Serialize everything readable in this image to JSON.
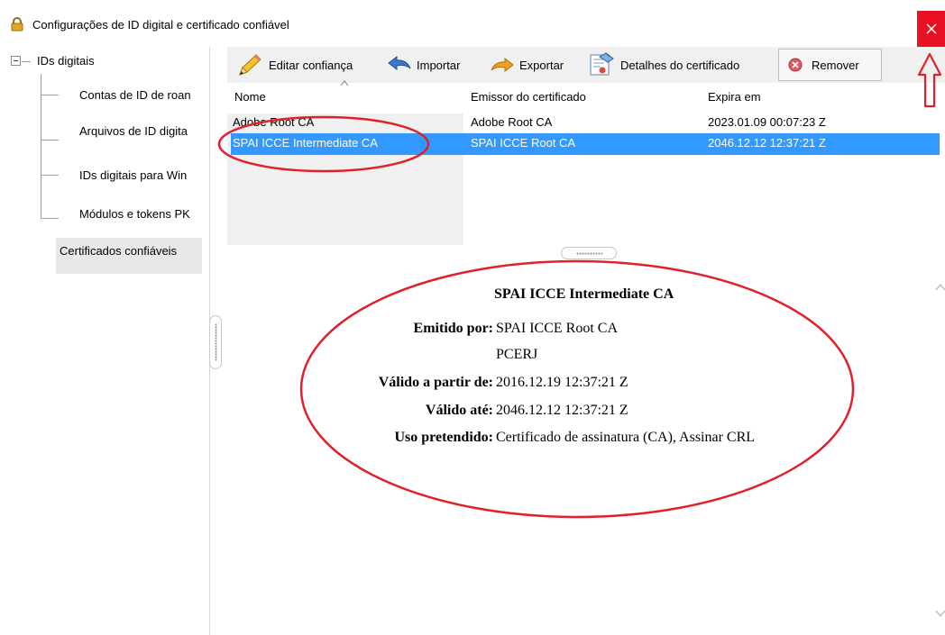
{
  "window": {
    "title": "Configurações de ID digital e certificado confiável",
    "accent_close": "#e81123"
  },
  "tree": {
    "root_label": "IDs digitais",
    "children": [
      "Contas de ID de roan",
      "Arquivos de ID digita",
      "IDs digitais para Win",
      "Módulos e tokens PK"
    ],
    "selected_label": "Certificados confiáveis"
  },
  "toolbar": {
    "edit_trust": "Editar confiança",
    "import": "Importar",
    "export": "Exportar",
    "cert_details": "Detalhes do certificado",
    "remove": "Remover"
  },
  "table": {
    "headers": [
      "Nome",
      "Emissor do certificado",
      "Expira em"
    ],
    "rows": [
      {
        "name": "Adobe Root CA",
        "issuer": "Adobe Root CA",
        "expires": "2023.01.09 00:07:23 Z"
      },
      {
        "name": "SPAI ICCE Intermediate CA",
        "issuer": "SPAI ICCE Root CA",
        "expires": "2046.12.12 12:37:21 Z"
      }
    ],
    "selection_color": "#3399ff"
  },
  "details": {
    "title": "SPAI ICCE Intermediate CA",
    "issued_by_label": "Emitido por:",
    "issued_by_value": "SPAI ICCE Root CA",
    "issued_by_org": "PCERJ",
    "valid_from_label": "Válido a partir de:",
    "valid_from_value": "2016.12.19 12:37:21 Z",
    "valid_until_label": "Válido até:",
    "valid_until_value": "2046.12.12 12:37:21 Z",
    "intended_use_label": "Uso pretendido:",
    "intended_use_value": "Certificado de assinatura (CA), Assinar CRL"
  },
  "annotations": {
    "color": "#e0202a",
    "icons": [
      "ellipse-highlight-row",
      "ellipse-highlight-details",
      "up-arrow-close"
    ]
  }
}
